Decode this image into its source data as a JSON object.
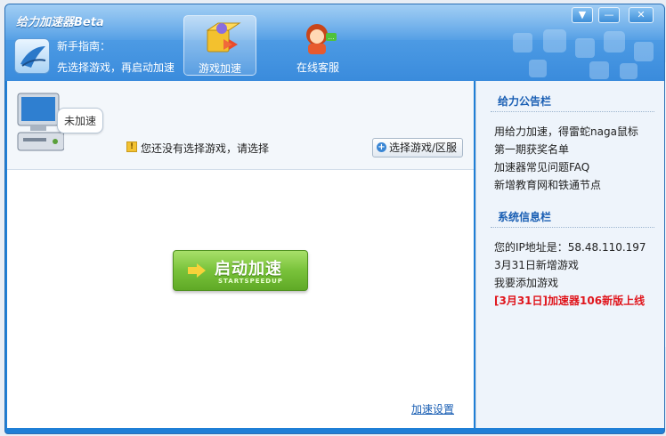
{
  "window": {
    "title": "给力加速器Beta",
    "controls": {
      "menu": "▼",
      "minimize": "—",
      "close": "✕"
    }
  },
  "guide": {
    "title": "新手指南：",
    "text": "先选择游戏，再启动加速"
  },
  "tabs": [
    {
      "label": "游戏加速",
      "icon": "game-box-icon",
      "active": true
    },
    {
      "label": "在线客服",
      "icon": "support-agent-icon",
      "active": false
    }
  ],
  "status": {
    "bubble": "未加速",
    "warning": "您还没有选择游戏，请选择",
    "warning_icon": "!",
    "select_button": "选择游戏/区服",
    "select_icon": "+"
  },
  "start": {
    "label": "启动加速",
    "sub": "STARTSPEEDUP"
  },
  "settings_link": "加速设置",
  "notice": {
    "title": "给力公告栏",
    "items": [
      "用给力加速，得雷蛇naga鼠标",
      "第一期获奖名单",
      "加速器常见问题FAQ",
      "新增教育网和铁通节点"
    ]
  },
  "sysinfo": {
    "title": "系统信息栏",
    "items": [
      "您的IP地址是：58.48.110.197",
      "3月31日新增游戏",
      "我要添加游戏"
    ],
    "highlight": "[3月31日]加速器106新版上线"
  },
  "colors": {
    "titlebar": "#4d9be4",
    "accent_link": "#1a5fb4",
    "start_green": "#79c23a",
    "highlight_red": "#e0161d"
  }
}
